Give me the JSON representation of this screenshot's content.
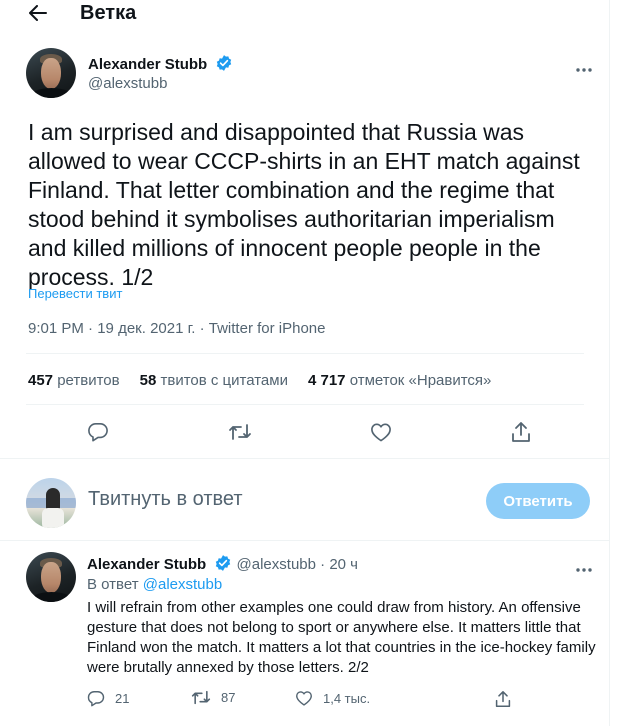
{
  "header": {
    "back_icon": "arrow-left-icon",
    "title": "Ветка"
  },
  "main_tweet": {
    "author_name": "Alexander Stubb",
    "handle": "@alexstubb",
    "text": "I am surprised and disappointed that Russia was allowed to wear CCCP-shirts in an EHT match against Finland. That letter combination and the regime that stood behind it symbolises authoritarian imperialism and killed millions of innocent people people in the process. 1/2",
    "translate_label": "Перевести твит",
    "time": "9:01 PM",
    "date": "19 дек. 2021 г.",
    "separator": "·",
    "client": "Twitter for iPhone",
    "stats": {
      "retweets_count": "457",
      "retweets_label": "ретвитов",
      "quotes_count": "58",
      "quotes_label": "твитов с цитатами",
      "likes_count": "4 717",
      "likes_label": "отметок «Нравится»"
    },
    "action_icons": [
      "reply-icon",
      "retweet-icon",
      "like-icon",
      "share-icon"
    ]
  },
  "reply_composer": {
    "placeholder": "Твитнуть в ответ",
    "button_label": "Ответить"
  },
  "reply_tweet": {
    "author_name": "Alexander Stubb",
    "handle": "@alexstubb",
    "dot": "·",
    "time": "20 ч",
    "in_reply_prefix": "В ответ",
    "in_reply_handle": "@alexstubb",
    "text": "I will refrain from other examples one could draw from history. An offensive gesture that does not belong to sport or anywhere else. It matters little that Finland won the match. It matters a lot that countries in the ice-hockey family were brutally annexed by those letters. 2/2",
    "replies": "21",
    "retweets": "87",
    "likes": "1,4 тыс."
  },
  "colors": {
    "accent": "#1d9bf0",
    "button_disabled": "#8ecdf8",
    "secondary_text": "#536471",
    "divider": "#eff3f4"
  }
}
